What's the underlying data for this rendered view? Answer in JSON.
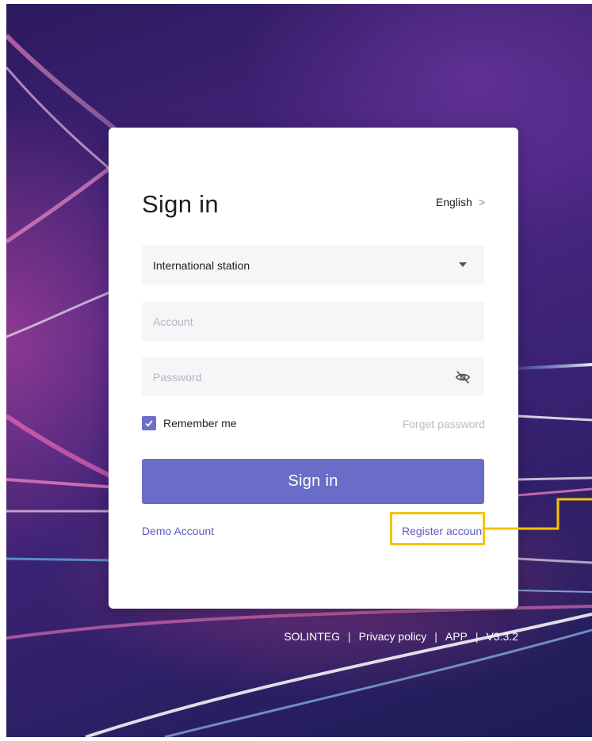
{
  "colors": {
    "accent": "#6a6dc8",
    "link": "#5b5ec0",
    "highlight": "#f5c400"
  },
  "login": {
    "title": "Sign in",
    "language_label": "English",
    "language_chevron": ">",
    "station_value": "International station",
    "account_placeholder": "Account",
    "password_placeholder": "Password",
    "remember_label": "Remember me",
    "remember_checked": true,
    "forget_label": "Forget password",
    "signin_label": "Sign in",
    "demo_label": "Demo Account",
    "register_label": "Register account"
  },
  "icons": {
    "station_dropdown": "caret-down-icon",
    "password_toggle": "eye-off-icon",
    "remember_check": "check-icon"
  },
  "footer": {
    "brand": "SOLINTEG",
    "privacy": "Privacy policy",
    "app": "APP",
    "version": "V3.3.2",
    "separator": "|"
  }
}
